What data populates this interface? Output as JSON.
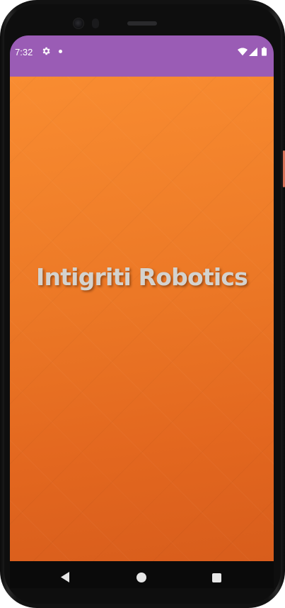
{
  "status_bar": {
    "time": "7:32",
    "icons": [
      "gear-icon",
      "notification-dot-icon",
      "wifi-icon",
      "signal-icon",
      "battery-icon"
    ],
    "background": "#9a5cb5"
  },
  "app": {
    "title": "Intigriti Robotics",
    "background_from": "#f98c31",
    "background_to": "#d85d1c"
  },
  "nav_bar": {
    "buttons": [
      "back-icon",
      "home-icon",
      "recents-icon"
    ]
  }
}
